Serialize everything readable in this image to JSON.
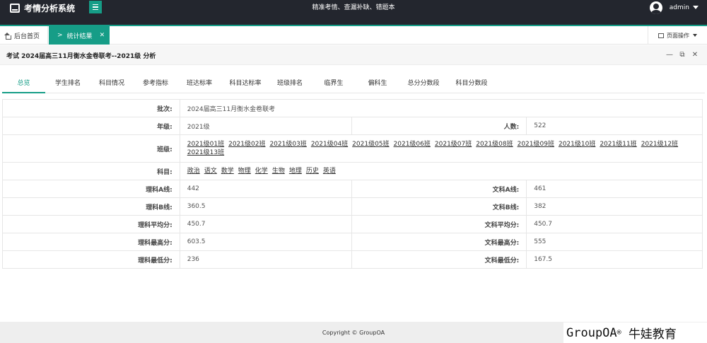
{
  "app": {
    "title": "考情分析系统",
    "slogan": "精准考情、查漏补缺、错题本",
    "user": "admin"
  },
  "tabs": {
    "home": "后台首页",
    "active": "统计结果",
    "page_ops": "页面操作"
  },
  "panel": {
    "title": "考试 2024届高三11月衡水金卷联考--2021级 分析"
  },
  "subtabs": [
    "总览",
    "学生排名",
    "科目情况",
    "参考指标",
    "班达标率",
    "科目达标率",
    "班级排名",
    "临界生",
    "偏科生",
    "总分分数段",
    "科目分数段"
  ],
  "info": {
    "batch_label": "批次:",
    "batch": "2024届高三11月衡水金卷联考",
    "grade_label": "年级:",
    "grade": "2021级",
    "count_label": "人数:",
    "count": "522",
    "class_label": "班级:",
    "classes": [
      "2021级01班",
      "2021级02班",
      "2021级03班",
      "2021级04班",
      "2021级05班",
      "2021级06班",
      "2021级07班",
      "2021级08班",
      "2021级09班",
      "2021级10班",
      "2021级11班",
      "2021级12班",
      "2021级13班"
    ],
    "subject_label": "科目:",
    "subjects": [
      "政治",
      "语文",
      "数学",
      "物理",
      "化学",
      "生物",
      "地理",
      "历史",
      "英语"
    ],
    "sci_a_label": "理科A线:",
    "sci_a": "442",
    "art_a_label": "文科A线:",
    "art_a": "461",
    "sci_b_label": "理科B线:",
    "sci_b": "360.5",
    "art_b_label": "文科B线:",
    "art_b": "382",
    "sci_avg_label": "理科平均分:",
    "sci_avg": "450.7",
    "art_avg_label": "文科平均分:",
    "art_avg": "450.7",
    "sci_max_label": "理科最高分:",
    "sci_max": "603.5",
    "art_max_label": "文科最高分:",
    "art_max": "555",
    "sci_min_label": "理科最低分:",
    "sci_min": "236",
    "art_min_label": "文科最低分:",
    "art_min": "167.5"
  },
  "footer": {
    "copyright": "Copyright © GroupOA",
    "watermark": "GroupOA",
    "watermark_mark": "®",
    "watermark_cn": "牛娃教育"
  },
  "colors": {
    "accent": "#169d87",
    "header": "#23262e"
  }
}
